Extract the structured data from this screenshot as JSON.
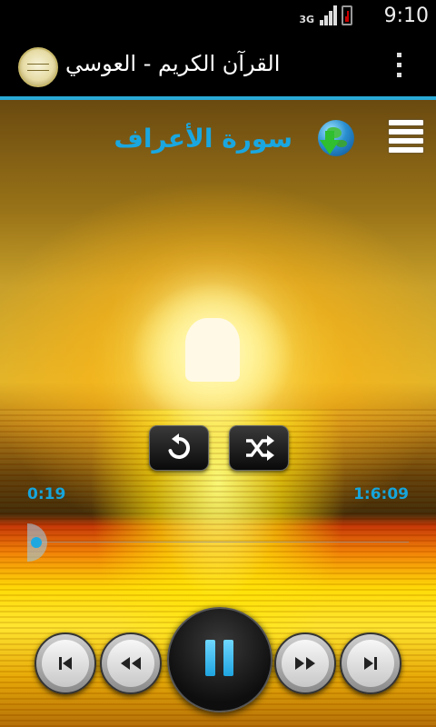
{
  "status_bar": {
    "network": "3G",
    "time": "9:10"
  },
  "action_bar": {
    "title": "القرآن الكريم - العوسي",
    "logo_icon": "reciter-logo"
  },
  "player": {
    "surah_title": "سورة الأعراف",
    "elapsed": "0:19",
    "duration": "1:6:09",
    "progress": 0.005,
    "state": "playing"
  },
  "icons": {
    "download": "globe-download-icon",
    "menu": "menu-icon",
    "repeat": "repeat-icon",
    "shuffle": "shuffle-icon",
    "previous": "skip-previous-icon",
    "rewind": "rewind-icon",
    "pause": "pause-icon",
    "forward": "fast-forward-icon",
    "next": "skip-next-icon"
  },
  "colors": {
    "accent": "#1aa7e0",
    "action_bar": "#000000"
  }
}
